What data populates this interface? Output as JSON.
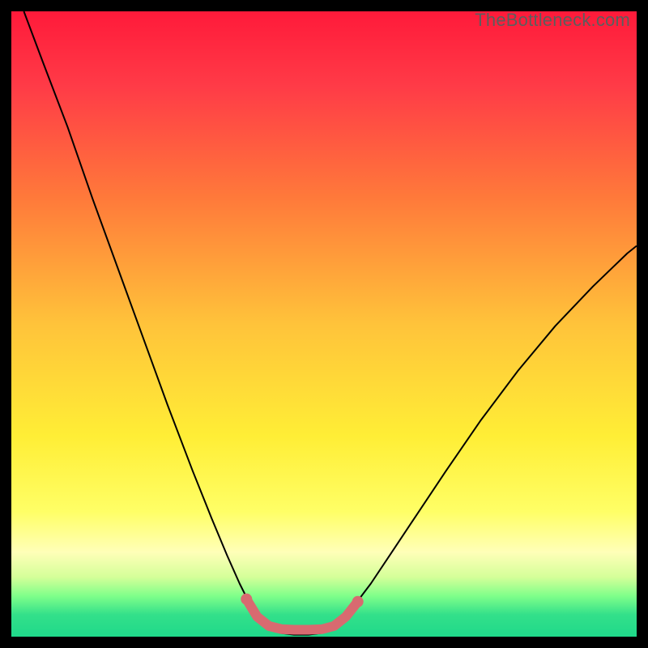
{
  "watermark": "TheBottleneck.com",
  "chart_data": {
    "type": "line",
    "title": "",
    "xlabel": "",
    "ylabel": "",
    "xlim": [
      0,
      1
    ],
    "ylim": [
      0,
      1
    ],
    "background_gradient": {
      "stops": [
        {
          "offset": 0.0,
          "color": "#ff1a3a"
        },
        {
          "offset": 0.12,
          "color": "#ff3b47"
        },
        {
          "offset": 0.3,
          "color": "#ff7a3a"
        },
        {
          "offset": 0.5,
          "color": "#ffc33a"
        },
        {
          "offset": 0.68,
          "color": "#ffee36"
        },
        {
          "offset": 0.8,
          "color": "#ffff66"
        },
        {
          "offset": 0.865,
          "color": "#ffffb8"
        },
        {
          "offset": 0.905,
          "color": "#d4ff99"
        },
        {
          "offset": 0.935,
          "color": "#7fff8a"
        },
        {
          "offset": 0.965,
          "color": "#33e08a"
        },
        {
          "offset": 1.0,
          "color": "#1fd98a"
        }
      ]
    },
    "series": [
      {
        "name": "bottleneck-curve",
        "stroke": "#000000",
        "stroke_width": 2,
        "points": [
          {
            "x": 0.02,
            "y": 1.0
          },
          {
            "x": 0.05,
            "y": 0.92
          },
          {
            "x": 0.09,
            "y": 0.815
          },
          {
            "x": 0.13,
            "y": 0.7
          },
          {
            "x": 0.17,
            "y": 0.59
          },
          {
            "x": 0.21,
            "y": 0.48
          },
          {
            "x": 0.25,
            "y": 0.37
          },
          {
            "x": 0.29,
            "y": 0.265
          },
          {
            "x": 0.32,
            "y": 0.19
          },
          {
            "x": 0.345,
            "y": 0.13
          },
          {
            "x": 0.365,
            "y": 0.085
          },
          {
            "x": 0.38,
            "y": 0.055
          },
          {
            "x": 0.395,
            "y": 0.03
          },
          {
            "x": 0.41,
            "y": 0.015
          },
          {
            "x": 0.43,
            "y": 0.006
          },
          {
            "x": 0.452,
            "y": 0.003
          },
          {
            "x": 0.475,
            "y": 0.003
          },
          {
            "x": 0.497,
            "y": 0.006
          },
          {
            "x": 0.515,
            "y": 0.015
          },
          {
            "x": 0.531,
            "y": 0.03
          },
          {
            "x": 0.55,
            "y": 0.052
          },
          {
            "x": 0.575,
            "y": 0.085
          },
          {
            "x": 0.605,
            "y": 0.13
          },
          {
            "x": 0.645,
            "y": 0.19
          },
          {
            "x": 0.695,
            "y": 0.265
          },
          {
            "x": 0.75,
            "y": 0.345
          },
          {
            "x": 0.81,
            "y": 0.425
          },
          {
            "x": 0.87,
            "y": 0.497
          },
          {
            "x": 0.93,
            "y": 0.56
          },
          {
            "x": 0.985,
            "y": 0.613
          },
          {
            "x": 1.0,
            "y": 0.625
          }
        ]
      },
      {
        "name": "highlight-segment",
        "stroke": "#d86a70",
        "stroke_width": 12,
        "linecap": "round",
        "points": [
          {
            "x": 0.376,
            "y": 0.06
          },
          {
            "x": 0.393,
            "y": 0.032
          },
          {
            "x": 0.412,
            "y": 0.017
          },
          {
            "x": 0.432,
            "y": 0.012
          },
          {
            "x": 0.452,
            "y": 0.011
          },
          {
            "x": 0.475,
            "y": 0.011
          },
          {
            "x": 0.497,
            "y": 0.012
          },
          {
            "x": 0.516,
            "y": 0.017
          },
          {
            "x": 0.535,
            "y": 0.032
          },
          {
            "x": 0.554,
            "y": 0.056
          }
        ]
      }
    ],
    "markers": [
      {
        "x": 0.376,
        "y": 0.06,
        "r": 7,
        "fill": "#d86a70"
      },
      {
        "x": 0.554,
        "y": 0.056,
        "r": 7,
        "fill": "#d86a70"
      }
    ]
  }
}
